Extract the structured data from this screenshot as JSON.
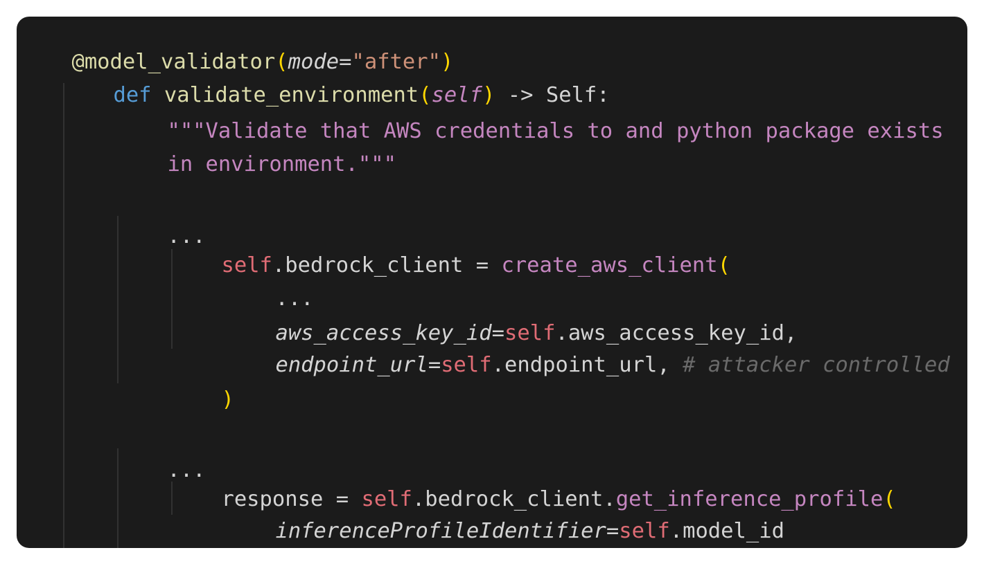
{
  "colors": {
    "background": "#1b1b1b",
    "page": "#ffffff",
    "decorator": "#dcdcaa",
    "keyword": "#569cd6",
    "string": "#ce9178",
    "docstring": "#c586c0",
    "self": "#e06c75",
    "paren": "#ffd700",
    "comment": "#6a6a6a",
    "plain": "#d4d4d4"
  },
  "code": {
    "line1": {
      "decorator": "@model_validator",
      "open": "(",
      "kw": "mode",
      "eq": "=",
      "val": "\"after\"",
      "close": ")"
    },
    "line2": {
      "def": "def",
      "name": "validate_environment",
      "open": "(",
      "param": "self",
      "close": ")",
      "ret": " -> Self:"
    },
    "line3": {
      "doc": "\"\"\"Validate that AWS credentials to and python package exists"
    },
    "line4": {
      "doc": "in environment.\"\"\""
    },
    "line5": {
      "text": "..."
    },
    "line6": {
      "self": "self",
      "rest": ".bedrock_client = ",
      "call": "create_aws_client",
      "open": "("
    },
    "line7": {
      "text": "..."
    },
    "line8": {
      "kw": "aws_access_key_id",
      "eq": "=",
      "self": "self",
      "rest": ".aws_access_key_id,"
    },
    "line9": {
      "kw": "endpoint_url",
      "eq": "=",
      "self": "self",
      "rest": ".endpoint_url, ",
      "comment": "# attacker controlled"
    },
    "line10": {
      "close": ")"
    },
    "line11": {
      "text": "..."
    },
    "line12": {
      "lhs": "response = ",
      "self": "self",
      "rest": ".bedrock_client.",
      "call": "get_inference_profile",
      "open": "("
    },
    "line13": {
      "kw": "inferenceProfileIdentifier",
      "eq": "=",
      "self": "self",
      "rest": ".model_id"
    },
    "line14": {
      "close": ")"
    }
  }
}
